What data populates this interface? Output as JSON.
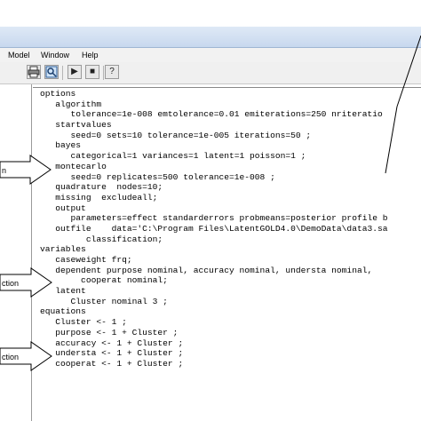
{
  "menu": {
    "items": [
      "Model",
      "Window",
      "Help"
    ]
  },
  "toolbar": {
    "buttons": [
      {
        "icon": "print-icon"
      },
      {
        "icon": "search-icon"
      },
      {
        "icon": "play-icon",
        "glyph": "▶"
      },
      {
        "icon": "stop-icon",
        "glyph": "■"
      },
      {
        "icon": "help-icon",
        "glyph": "?"
      }
    ]
  },
  "callouts": [
    {
      "text": "n"
    },
    {
      "text": "ction"
    },
    {
      "text": "ction"
    }
  ],
  "code_lines": [
    "options",
    "   algorithm",
    "      tolerance=1e-008 emtolerance=0.01 emiterations=250 nriteratio",
    "   startvalues",
    "      seed=0 sets=10 tolerance=1e-005 iterations=50 ;",
    "   bayes",
    "      categorical=1 variances=1 latent=1 poisson=1 ;",
    "   montecarlo",
    "      seed=0 replicates=500 tolerance=1e-008 ;",
    "   quadrature  nodes=10;",
    "   missing  excludeall;",
    "   output",
    "      parameters=effect standarderrors probmeans=posterior profile b",
    "   outfile    data='C:\\Program Files\\LatentGOLD4.0\\DemoData\\data3.sa",
    "         classification;",
    "variables",
    "   caseweight frq;",
    "   dependent purpose nominal, accuracy nominal, understa nominal,",
    "        cooperat nominal;",
    "   latent",
    "      Cluster nominal 3 ;",
    "equations",
    "   Cluster <- 1 ;",
    "   purpose <- 1 + Cluster ;",
    "   accuracy <- 1 + Cluster ;",
    "   understa <- 1 + Cluster ;",
    "   cooperat <- 1 + Cluster ;"
  ]
}
